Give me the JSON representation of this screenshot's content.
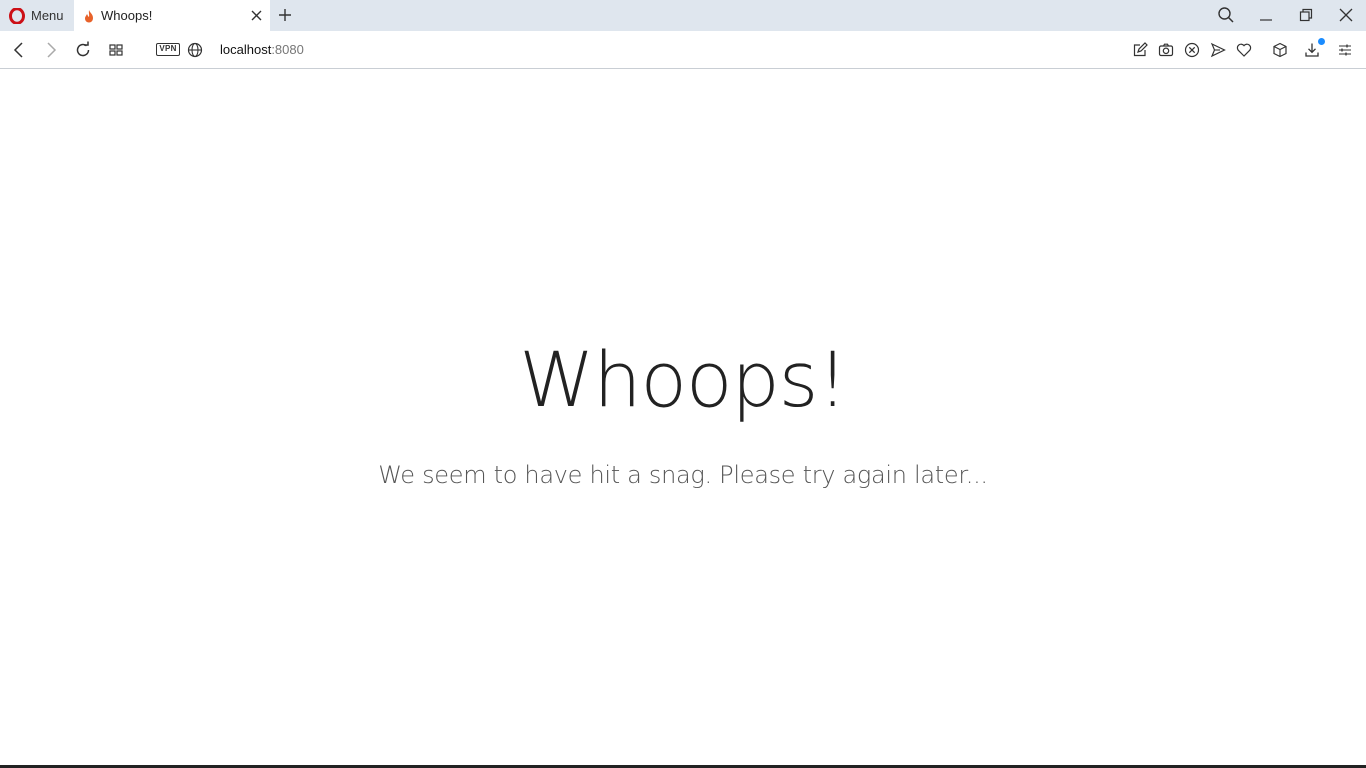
{
  "browser": {
    "menu_label": "Menu",
    "tab": {
      "title": "Whoops!",
      "favicon": "flame-icon"
    },
    "address": {
      "host": "localhost",
      "port": ":8080"
    },
    "vpn_label": "VPN",
    "accent_color": "#1a8cff",
    "brand_color": "#cc0f16"
  },
  "page": {
    "headline": "Whoops!",
    "message": "We seem to have hit a snag. Please try again later..."
  }
}
